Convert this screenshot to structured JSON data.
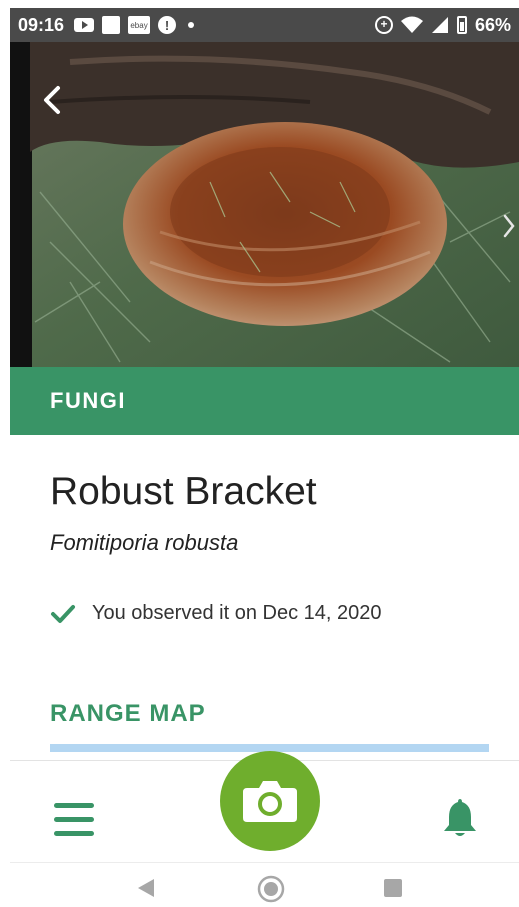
{
  "status_bar": {
    "time": "09:16",
    "ebay_label": "ebay",
    "alert_glyph": "!",
    "battery": "66%",
    "icons": [
      "youtube-icon",
      "square-icon",
      "ebay-icon",
      "alert-icon",
      "dot-icon",
      "sync-icon",
      "wifi-icon",
      "signal-icon",
      "battery-icon"
    ]
  },
  "photo": {
    "icons": [
      "back-arrow-icon",
      "next-arrow-icon"
    ]
  },
  "category": "FUNGI",
  "species": {
    "common_name": "Robust Bracket",
    "scientific_name": "Fomitiporia robusta"
  },
  "observation": {
    "text": "You observed it on Dec 14, 2020"
  },
  "range_map": {
    "heading": "RANGE MAP"
  },
  "bottom_nav": {
    "icons": [
      "menu-icon",
      "camera-icon",
      "bell-icon"
    ]
  },
  "colors": {
    "accent_green": "#399466",
    "camera_green": "#6fae2d",
    "status_bar": "#4a4a4a",
    "map_strip": "#b3d6f2"
  }
}
